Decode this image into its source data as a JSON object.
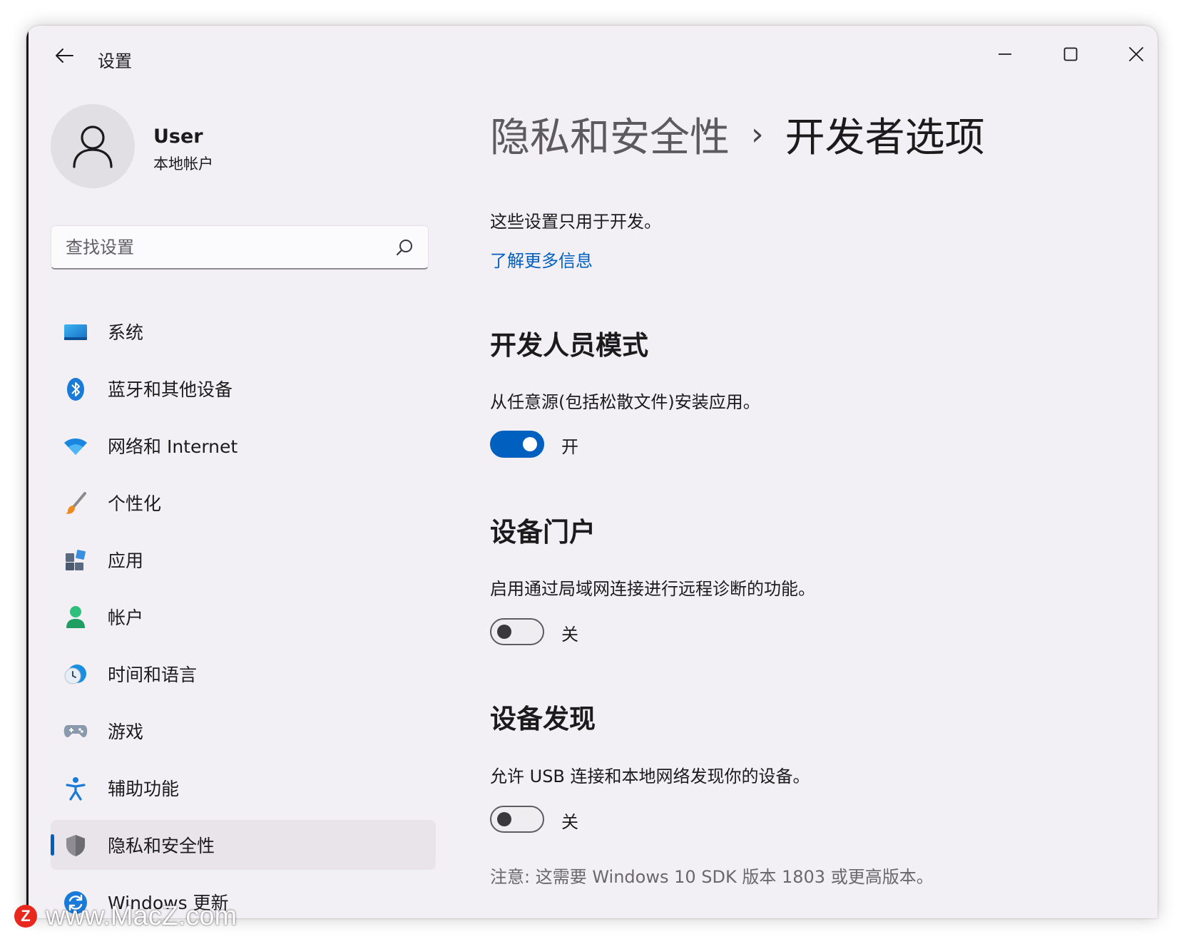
{
  "window": {
    "title": "设置",
    "controls": {
      "minimize": "minimize",
      "maximize": "maximize",
      "close": "close"
    }
  },
  "user": {
    "name": "User",
    "account_type": "本地帐户"
  },
  "search": {
    "placeholder": "查找设置",
    "value": ""
  },
  "sidebar": {
    "items": [
      {
        "label": "系统",
        "icon": "system-icon",
        "active": false
      },
      {
        "label": "蓝牙和其他设备",
        "icon": "bluetooth-icon",
        "active": false
      },
      {
        "label": "网络和 Internet",
        "icon": "wifi-icon",
        "active": false
      },
      {
        "label": "个性化",
        "icon": "brush-icon",
        "active": false
      },
      {
        "label": "应用",
        "icon": "apps-icon",
        "active": false
      },
      {
        "label": "帐户",
        "icon": "account-icon",
        "active": false
      },
      {
        "label": "时间和语言",
        "icon": "time-language-icon",
        "active": false
      },
      {
        "label": "游戏",
        "icon": "gamepad-icon",
        "active": false
      },
      {
        "label": "辅助功能",
        "icon": "accessibility-icon",
        "active": false
      },
      {
        "label": "隐私和安全性",
        "icon": "shield-icon",
        "active": true
      },
      {
        "label": "Windows 更新",
        "icon": "windows-update-icon",
        "active": false
      }
    ]
  },
  "main": {
    "breadcrumb": {
      "parent": "隐私和安全性",
      "separator": "›",
      "current": "开发者选项"
    },
    "intro": "这些设置只用于开发。",
    "learn_more": "了解更多信息",
    "sections": [
      {
        "title": "开发人员模式",
        "description": "从任意源(包括松散文件)安装应用。",
        "toggle_on": true,
        "toggle_label": "开"
      },
      {
        "title": "设备门户",
        "description": "启用通过局域网连接进行远程诊断的功能。",
        "toggle_on": false,
        "toggle_label": "关"
      },
      {
        "title": "设备发现",
        "description": "允许 USB 连接和本地网络发现你的设备。",
        "toggle_on": false,
        "toggle_label": "关"
      }
    ],
    "note": "注意: 这需要 Windows 10 SDK 版本 1803 或更高版本。"
  },
  "watermark": {
    "logo": "Z",
    "text": "www.MacZ.com"
  },
  "colors": {
    "accent": "#0060c0",
    "window_bg": "#f3f0f5",
    "active_nav_bg": "#e8e4ea"
  }
}
